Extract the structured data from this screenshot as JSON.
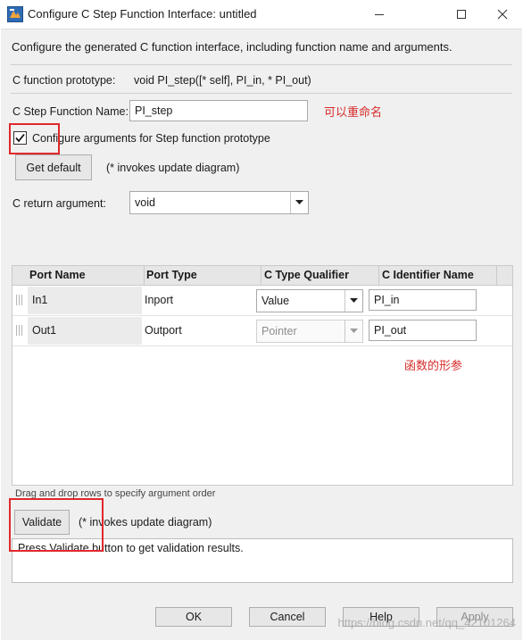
{
  "window": {
    "title": "Configure C Step Function Interface: untitled"
  },
  "description": "Configure the generated C function interface, including function name and arguments.",
  "prototype": {
    "label": "C function prototype:",
    "value": "void PI_step([* self], PI_in, * PI_out)"
  },
  "step_function": {
    "label": "C Step Function Name:",
    "value": "PI_step",
    "annotation": "可以重命名"
  },
  "configure_args": {
    "label": "Configure arguments for Step function prototype",
    "checked": true
  },
  "get_default": {
    "label": "Get default",
    "note": "(* invokes update diagram)"
  },
  "return_arg": {
    "label": "C return argument:",
    "value": "void"
  },
  "table": {
    "columns": [
      "Port Name",
      "Port Type",
      "C Type Qualifier",
      "C Identifier Name"
    ],
    "rows": [
      {
        "port_name": "In1",
        "port_type": "Inport",
        "qualifier": "Value",
        "identifier": "PI_in",
        "qualifier_enabled": true
      },
      {
        "port_name": "Out1",
        "port_type": "Outport",
        "qualifier": "Pointer",
        "identifier": "PI_out",
        "qualifier_enabled": false
      }
    ],
    "annotation": "函数的形参"
  },
  "drag_hint": "Drag and drop rows to specify argument order",
  "validate": {
    "label": "Validate",
    "note": "(* invokes update diagram)",
    "result": "Press Validate button to get validation results."
  },
  "buttons": {
    "ok": "OK",
    "cancel": "Cancel",
    "help": "Help",
    "apply": "Apply"
  },
  "watermark": "https://blog.csdn.net/qq_42101264",
  "colors": {
    "annotation_red": "#e0282c",
    "dialog_bg": "#f0f0f0"
  }
}
